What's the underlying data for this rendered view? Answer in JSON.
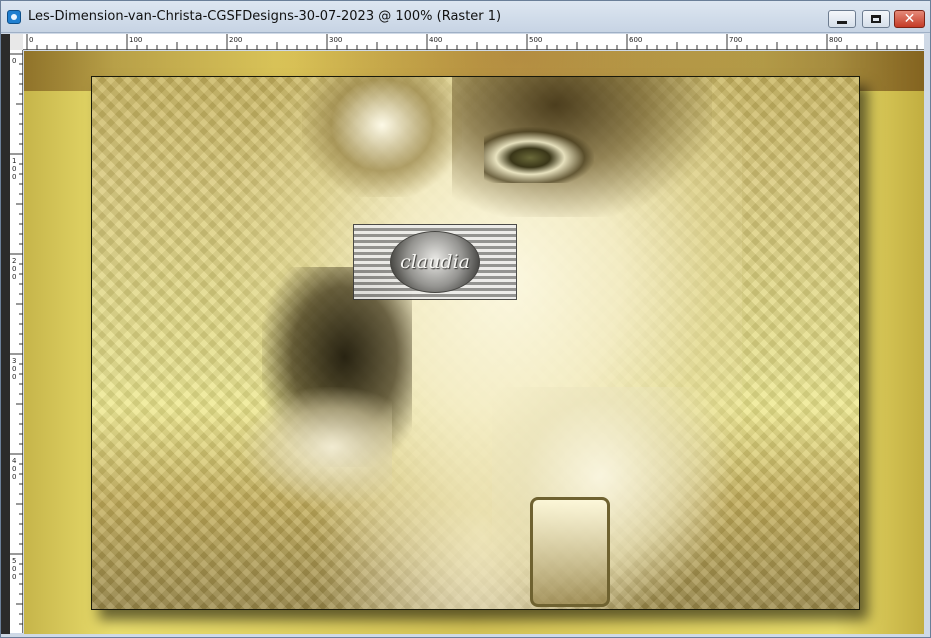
{
  "window": {
    "title": "Les-Dimension-van-Christa-CGSFDesigns-30-07-2023 @ 100% (Raster 1)",
    "app_icon": "paintshop-pro-icon",
    "controls": {
      "minimize_icon": "minimize-icon",
      "maximize_icon": "maximize-icon",
      "close_glyph": "✕"
    }
  },
  "rulers": {
    "top_labels": [
      "0",
      "100",
      "200",
      "300",
      "400",
      "500",
      "600",
      "700",
      "800"
    ],
    "left_labels": [
      "0",
      "100",
      "200",
      "300",
      "400",
      "500"
    ]
  },
  "canvas": {
    "watermark_text": "claudia",
    "colors": {
      "background": "#d3c254",
      "frame_border": "#1a1a0a",
      "highlight": "#efe98e"
    }
  }
}
